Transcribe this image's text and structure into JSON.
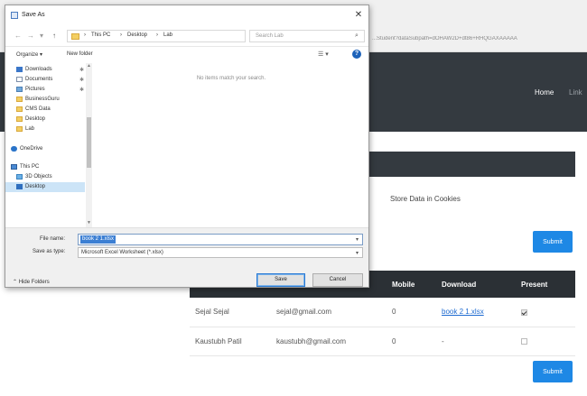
{
  "browser": {
    "url": "...Student?dataSubpath=dOHAW2D+dt86+RHQGAXAAAAA"
  },
  "site": {
    "nav_home": "Home",
    "nav_link": "Link",
    "store_label": "Store Data in Cookies",
    "submit_label": "Submit",
    "table": {
      "headers": [
        "",
        "",
        "Mobile",
        "Download",
        "Present"
      ],
      "rows": [
        {
          "name": "Sejal Sejal",
          "email": "sejal@gmail.com",
          "mobile": "0",
          "download": "book 2 1.xlsx",
          "present": true
        },
        {
          "name": "Kaustubh Patil",
          "email": "kaustubh@gmail.com",
          "mobile": "0",
          "download": "-",
          "present": false
        }
      ]
    }
  },
  "dialog": {
    "title": "Save As",
    "close": "✕",
    "breadcrumbs": [
      "This PC",
      "Desktop",
      "Lab"
    ],
    "search_placeholder": "Search Lab",
    "toolbar": {
      "organize": "Organize ▾",
      "new_folder": "New folder",
      "view": "☰ ▾",
      "help": "?"
    },
    "nav_items": [
      {
        "label": "Downloads",
        "icon": "ic-down",
        "pinned": true
      },
      {
        "label": "Documents",
        "icon": "ic-doc",
        "pinned": true
      },
      {
        "label": "Pictures",
        "icon": "ic-pic",
        "pinned": true
      },
      {
        "label": "BusinessGuru",
        "icon": "ic-folder",
        "pinned": false
      },
      {
        "label": "CMS Data",
        "icon": "ic-folder",
        "pinned": false
      },
      {
        "label": "Desktop",
        "icon": "ic-folder",
        "pinned": false
      },
      {
        "label": "Lab",
        "icon": "ic-folder",
        "pinned": false
      },
      {
        "label": "",
        "icon": "",
        "pinned": false
      },
      {
        "label": "OneDrive",
        "icon": "ic-cloud",
        "pinned": false
      },
      {
        "label": "",
        "icon": "",
        "pinned": false
      },
      {
        "label": "This PC",
        "icon": "ic-pc",
        "pinned": false
      },
      {
        "label": "3D Objects",
        "icon": "ic-3d",
        "pinned": false
      },
      {
        "label": "Desktop",
        "icon": "ic-desk",
        "pinned": false,
        "selected": true
      }
    ],
    "empty_message": "No items match your search.",
    "file_name_label": "File name:",
    "file_name_value": "book 2 1.xlsx",
    "save_type_label": "Save as type:",
    "save_type_value": "Microsoft Excel Worksheet (*.xlsx)",
    "hide_folders": "Hide Folders",
    "save_button": "Save",
    "cancel_button": "Cancel"
  }
}
